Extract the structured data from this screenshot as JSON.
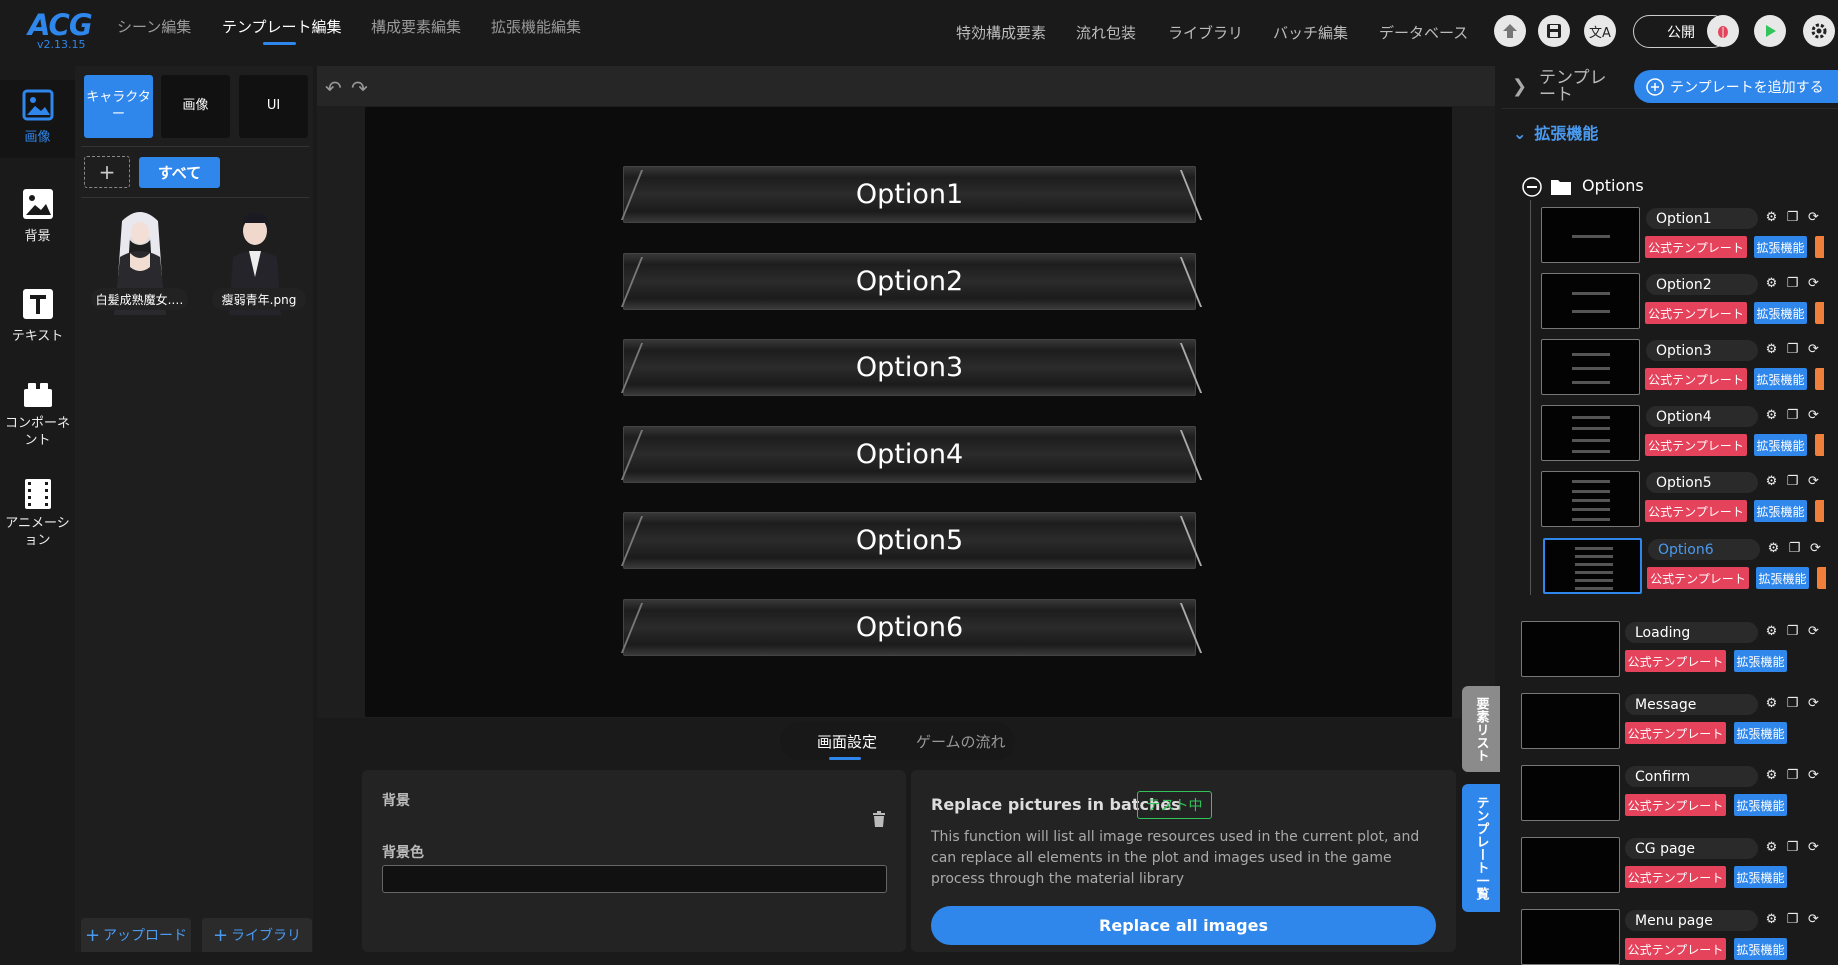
{
  "app": {
    "logo": "ACG",
    "version": "v2.13.15"
  },
  "top_tabs": [
    "シーン編集",
    "テンプレート編集",
    "構成要素編集",
    "拡張機能編集"
  ],
  "right_nav": [
    "特効構成要素",
    "流れ包装",
    "ライブラリ",
    "バッチ編集",
    "データベース"
  ],
  "publish_label": "公開",
  "rail": [
    {
      "label": "画像",
      "icon": "image-icon"
    },
    {
      "label": "背景",
      "icon": "background-icon"
    },
    {
      "label": "テキスト",
      "icon": "text-icon"
    },
    {
      "label": "コンポーネント",
      "icon": "component-icon"
    },
    {
      "label": "アニメーション",
      "icon": "animation-icon"
    }
  ],
  "asset_tabs": [
    "キャラクター",
    "画像",
    "UI"
  ],
  "all_label": "すべて",
  "assets": [
    "白髪成熟魔女.…",
    "瘦弱青年.png"
  ],
  "upload_label": "アップロード",
  "library_label": "ライブラリ",
  "options": [
    "Option1",
    "Option2",
    "Option3",
    "Option4",
    "Option5",
    "Option6"
  ],
  "bottom_tabs": [
    "画面設定",
    "ゲームの流れ"
  ],
  "bg_card": {
    "title": "背景",
    "color_label": "背景色"
  },
  "replace_card": {
    "title": "Replace pictures in batches",
    "badge": "テスト中",
    "description": "This function will list all image resources used in the current plot, and can replace all elements in the plot and images used in the game process through the material library",
    "button": "Replace all images"
  },
  "vertical_tabs": [
    "要素リスト",
    "テンプレート一覧"
  ],
  "right_panel": {
    "title": "テンプレート",
    "add_button": "テンプレートを追加する",
    "ext_header": "拡張機能",
    "group": "Options",
    "tag_official": "公式テンプレート",
    "tag_ext": "拡張機能",
    "children": [
      "Option1",
      "Option2",
      "Option3",
      "Option4",
      "Option5",
      "Option6"
    ],
    "selected": "Option6",
    "templates": [
      "Loading",
      "Message",
      "Confirm",
      "CG page",
      "Menu page"
    ]
  },
  "colors": {
    "accent": "#2f86eb",
    "official_tag": "#e5425b",
    "test_badge": "#32c45a"
  }
}
